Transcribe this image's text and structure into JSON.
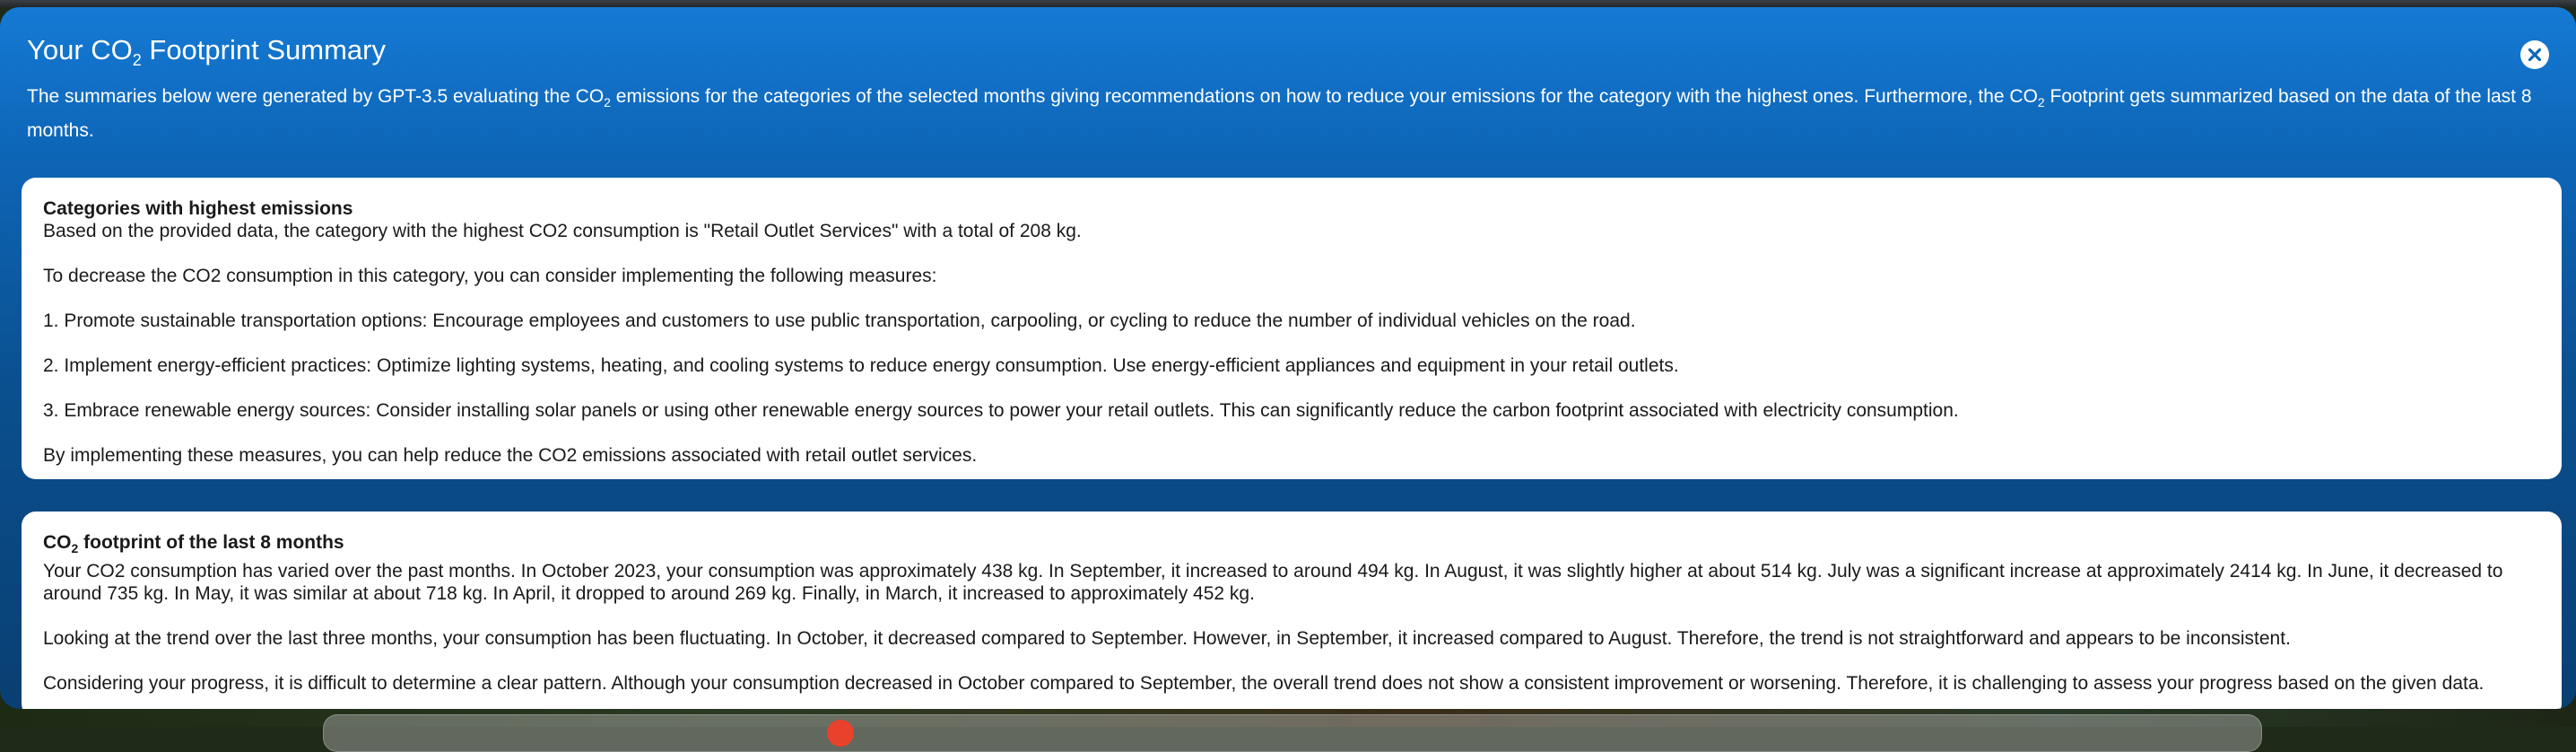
{
  "modal": {
    "title_prefix": "Your CO",
    "title_sub": "2",
    "title_suffix": " Footprint Summary",
    "description_part1": "The summaries below were generated by GPT-3.5 evaluating the CO",
    "description_sub1": "2",
    "description_part2": " emissions for the categories of the selected months giving recommendations on how to reduce your emissions for the category with the highest ones. Furthermore, the CO",
    "description_sub2": "2",
    "description_part3": " Footprint gets summarized based on the data of the last 8 months."
  },
  "highest_emissions": {
    "heading": "Categories with highest emissions",
    "paragraphs": [
      "Based on the provided data, the category with the highest CO2 consumption is \"Retail Outlet Services\" with a total of 208 kg.",
      "To decrease the CO2 consumption in this category, you can consider implementing the following measures:",
      "1. Promote sustainable transportation options: Encourage employees and customers to use public transportation, carpooling, or cycling to reduce the number of individual vehicles on the road.",
      "2. Implement energy-efficient practices: Optimize lighting systems, heating, and cooling systems to reduce energy consumption. Use energy-efficient appliances and equipment in your retail outlets.",
      "3. Embrace renewable energy sources: Consider installing solar panels or using other renewable energy sources to power your retail outlets. This can significantly reduce the carbon footprint associated with electricity consumption.",
      "By implementing these measures, you can help reduce the CO2 emissions associated with retail outlet services."
    ]
  },
  "footprint_8_months": {
    "heading_prefix": "CO",
    "heading_sub": "2",
    "heading_suffix": " footprint of the last 8 months",
    "paragraphs": [
      "Your CO2 consumption has varied over the past months. In October 2023, your consumption was approximately 438 kg. In September, it increased to around 494 kg. In August, it was slightly higher at about 514 kg. July was a significant increase at approximately 2414 kg. In June, it decreased to around 735 kg. In May, it was similar at about 718 kg. In April, it dropped to around 269 kg. Finally, in March, it increased to approximately 452 kg.",
      "Looking at the trend over the last three months, your consumption has been fluctuating. In October, it decreased compared to September. However, in September, it increased compared to August. Therefore, the trend is not straightforward and appears to be inconsistent.",
      "Considering your progress, it is difficult to determine a clear pattern. Although your consumption decreased in October compared to September, the overall trend does not show a consistent improvement or worsening. Therefore, it is challenging to assess your progress based on the given data."
    ]
  },
  "icons": {
    "close": "close-icon"
  },
  "colors": {
    "accent": "#0e66b8",
    "card": "#ffffff",
    "text": "#1a1a1a"
  }
}
